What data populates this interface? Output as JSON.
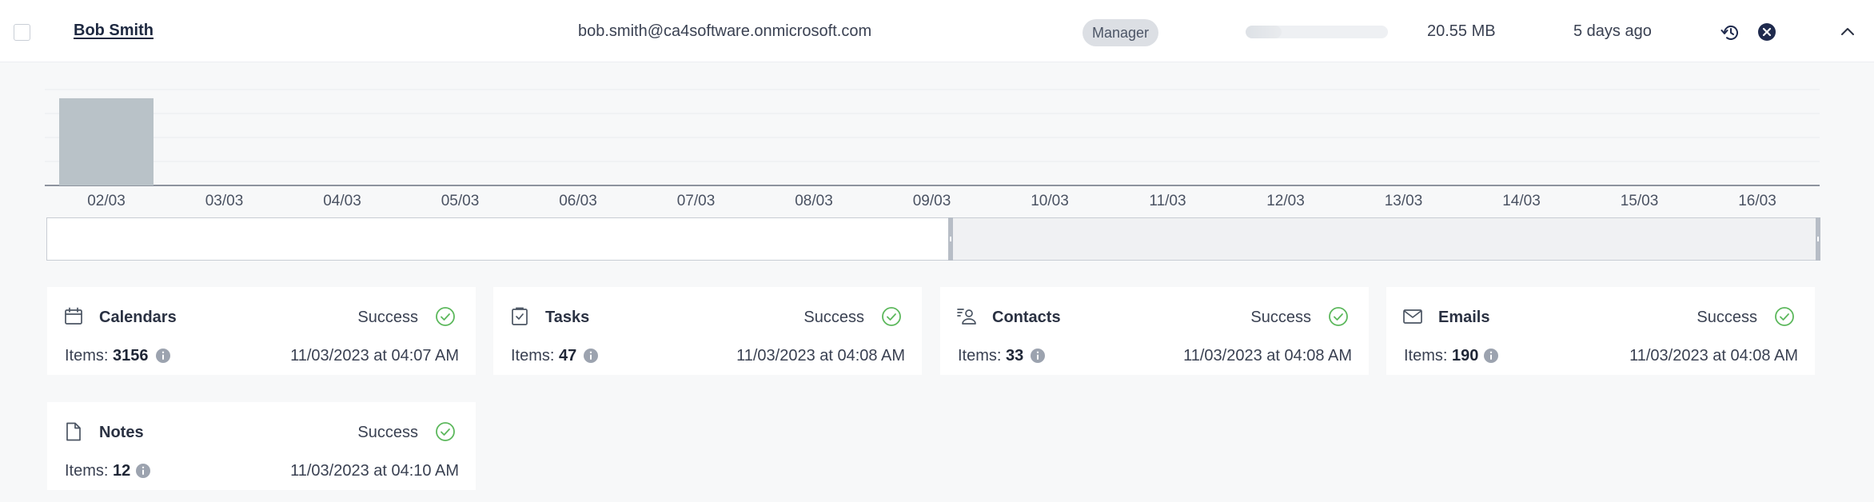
{
  "user": {
    "name": "Bob Smith",
    "email": "bob.smith@ca4software.onmicrosoft.com",
    "role": "Manager",
    "usage_fraction": 0.25,
    "size": "20.55 MB",
    "last_backup": "5 days ago"
  },
  "icons": {
    "restore": "restore-icon",
    "remove": "close-circle-icon",
    "collapse": "chevron-up-icon"
  },
  "colors": {
    "success": "#5cb85c",
    "bar": "#b9c2c8",
    "remove": "#1f2a4d"
  },
  "chart_data": {
    "type": "bar",
    "categories": [
      "02/03",
      "03/03",
      "04/03",
      "05/03",
      "06/03",
      "07/03",
      "08/03",
      "09/03",
      "10/03",
      "11/03",
      "12/03",
      "13/03",
      "14/03",
      "15/03",
      "16/03"
    ],
    "values": [
      1,
      0,
      0,
      0,
      0,
      0,
      0,
      0,
      0,
      0,
      0,
      0,
      0,
      0,
      0
    ],
    "ylim": [
      0,
      1.1
    ],
    "grid": true,
    "range_selection": [
      "09/03",
      "16/03"
    ]
  },
  "cards": [
    {
      "title": "Calendars",
      "status": "Success",
      "items_label": "Items:",
      "items": "3156",
      "date": "11/03/2023 at 04:07 AM",
      "icon": "calendar-icon"
    },
    {
      "title": "Tasks",
      "status": "Success",
      "items_label": "Items:",
      "items": "47",
      "date": "11/03/2023 at 04:08 AM",
      "icon": "task-icon"
    },
    {
      "title": "Contacts",
      "status": "Success",
      "items_label": "Items:",
      "items": "33",
      "date": "11/03/2023 at 04:08 AM",
      "icon": "contacts-icon"
    },
    {
      "title": "Emails",
      "status": "Success",
      "items_label": "Items:",
      "items": "190",
      "date": "11/03/2023 at 04:08 AM",
      "icon": "envelope-icon"
    },
    {
      "title": "Notes",
      "status": "Success",
      "items_label": "Items:",
      "items": "12",
      "date": "11/03/2023 at 04:10 AM",
      "icon": "note-icon"
    }
  ]
}
